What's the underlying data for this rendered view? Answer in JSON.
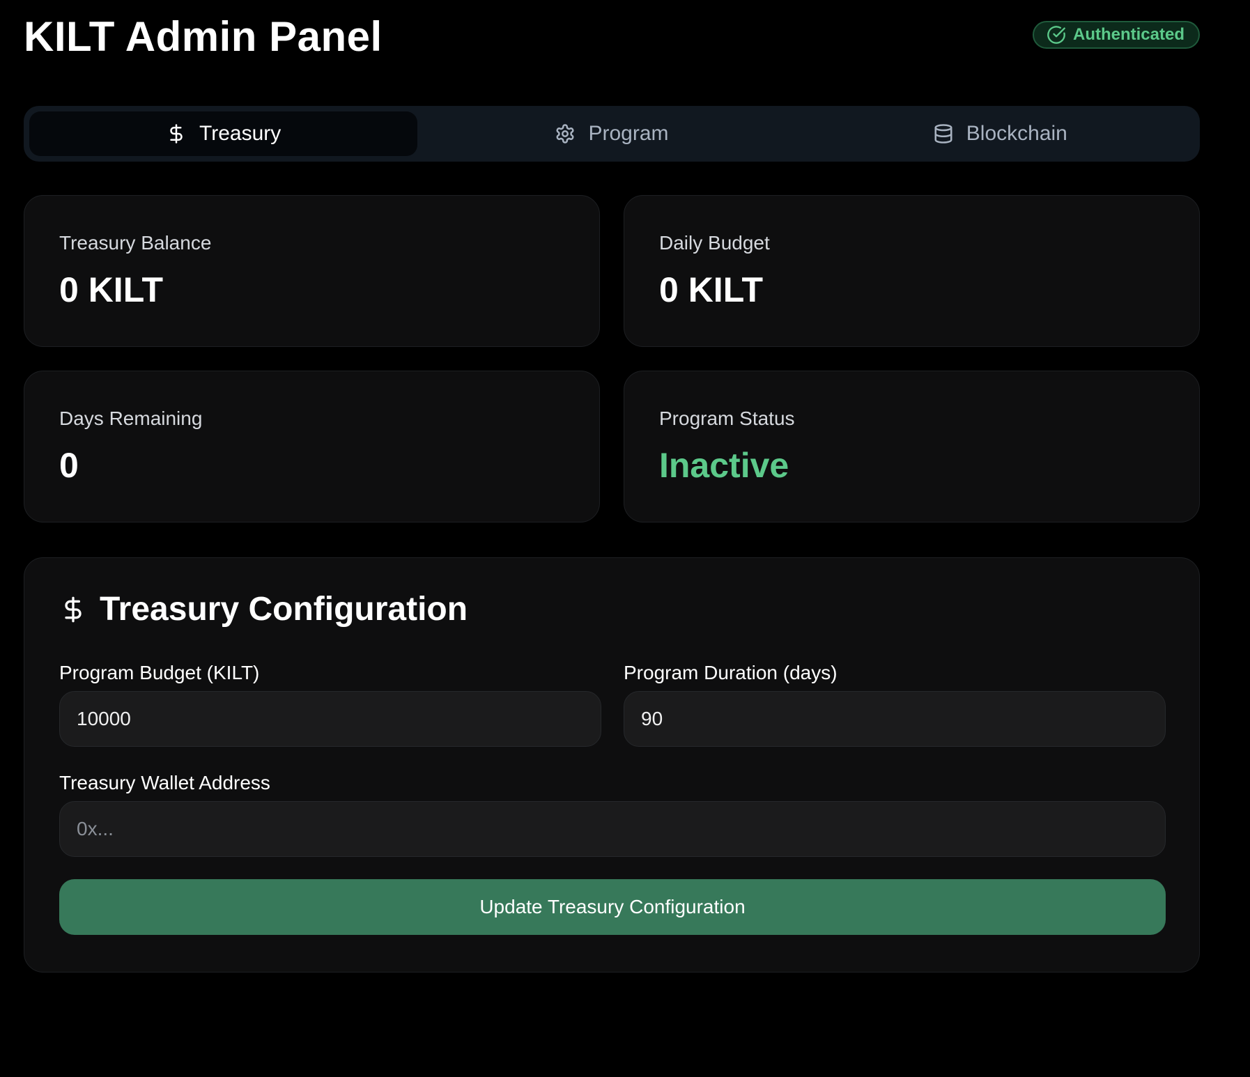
{
  "header": {
    "title": "KILT Admin Panel",
    "auth_badge": "Authenticated"
  },
  "tabs": [
    {
      "label": "Treasury",
      "icon": "dollar-icon",
      "active": true
    },
    {
      "label": "Program",
      "icon": "gear-icon",
      "active": false
    },
    {
      "label": "Blockchain",
      "icon": "database-icon",
      "active": false
    }
  ],
  "stats": {
    "treasury_balance": {
      "label": "Treasury Balance",
      "value": "0 KILT"
    },
    "daily_budget": {
      "label": "Daily Budget",
      "value": "0 KILT"
    },
    "days_remaining": {
      "label": "Days Remaining",
      "value": "0"
    },
    "program_status": {
      "label": "Program Status",
      "value": "Inactive"
    }
  },
  "config": {
    "title": "Treasury Configuration",
    "budget": {
      "label": "Program Budget (KILT)",
      "value": "10000"
    },
    "duration": {
      "label": "Program Duration (days)",
      "value": "90"
    },
    "wallet": {
      "label": "Treasury Wallet Address",
      "value": "",
      "placeholder": "0x..."
    },
    "submit_label": "Update Treasury Configuration"
  },
  "colors": {
    "background": "#000000",
    "card": "#0e0e0f",
    "accent_green": "#5cc98a",
    "button_green": "#37795a",
    "tab_bar": "#111820"
  }
}
